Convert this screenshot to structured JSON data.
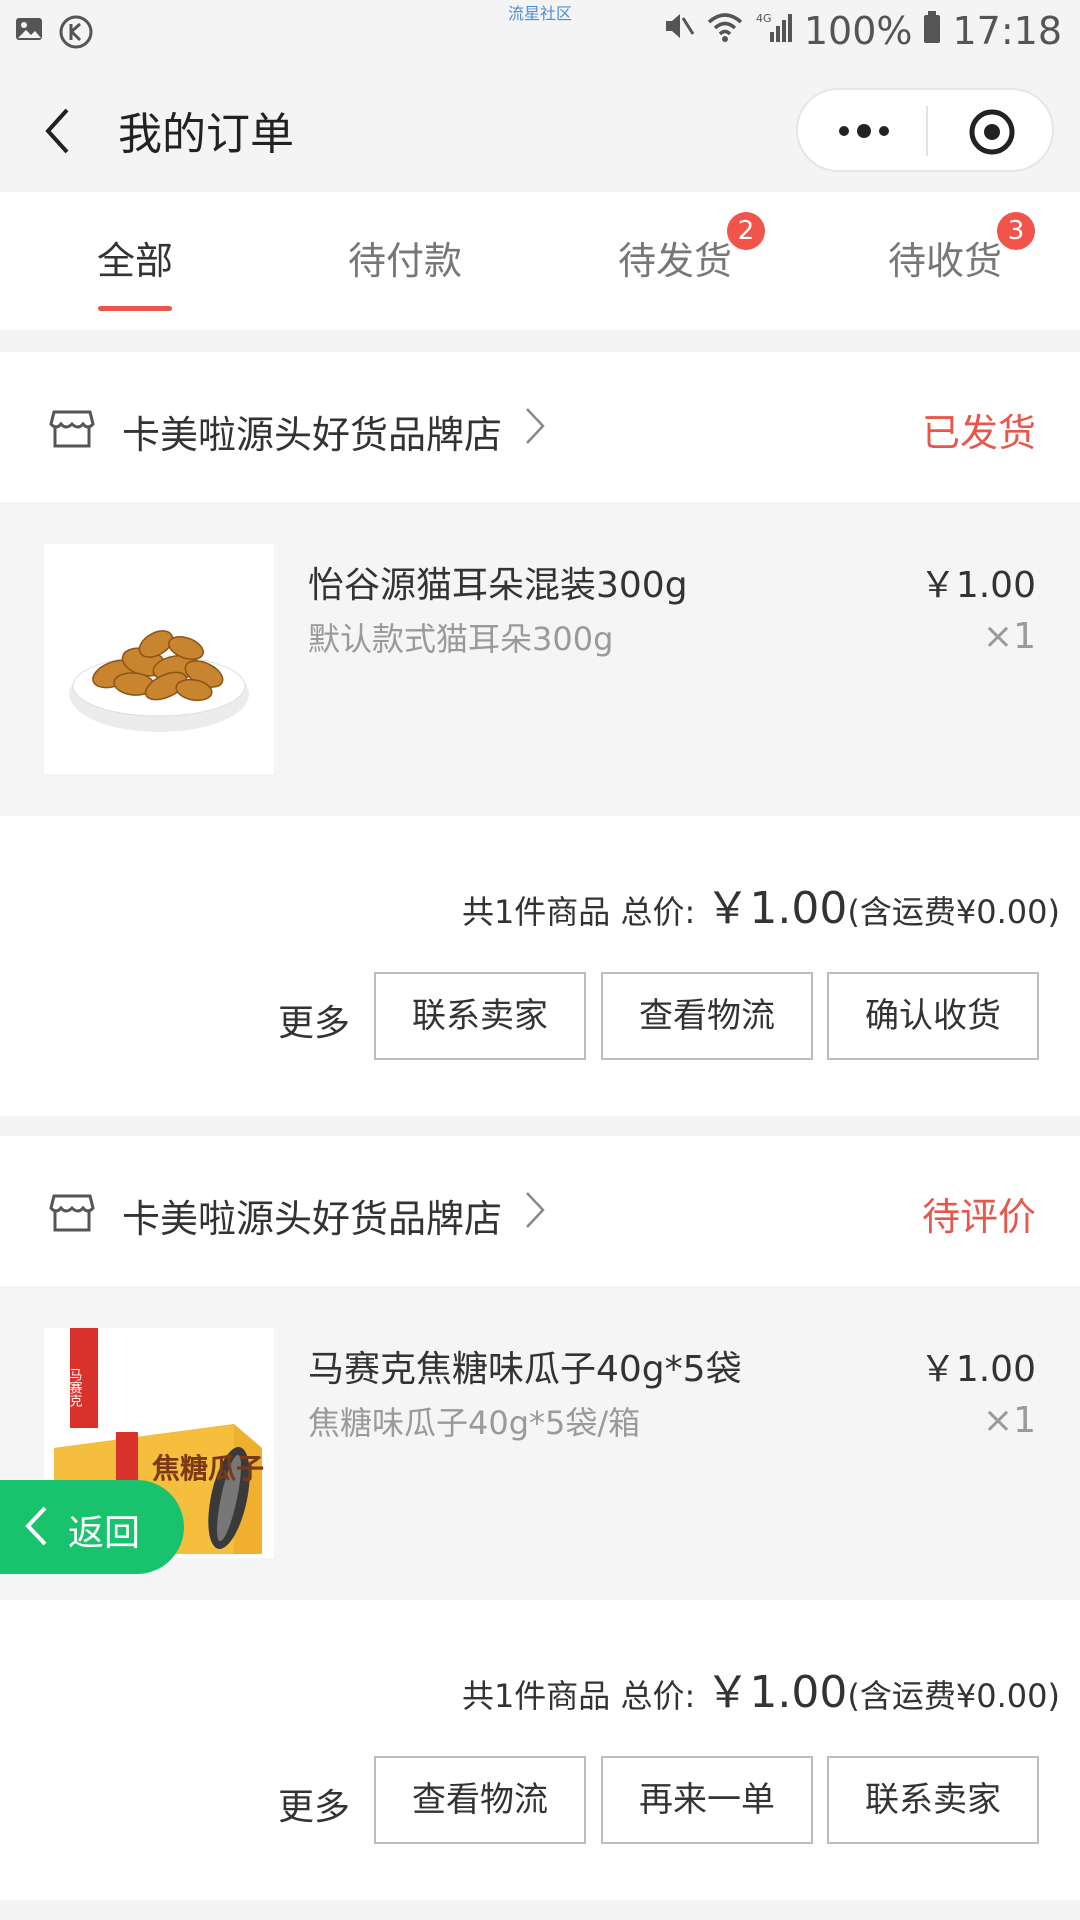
{
  "status_bar": {
    "watermark": "流星社区",
    "battery": "100%",
    "time": "17:18",
    "network": "4G"
  },
  "nav": {
    "title": "我的订单"
  },
  "tabs": [
    {
      "label": "全部",
      "active": true
    },
    {
      "label": "待付款"
    },
    {
      "label": "待发货",
      "badge": "2"
    },
    {
      "label": "待收货",
      "badge": "3"
    }
  ],
  "orders": [
    {
      "shop": "卡美啦源头好货品牌店",
      "status": "已发货",
      "item": {
        "name": "怡谷源猫耳朵混装300g",
        "spec": "默认款式猫耳朵300g",
        "price": "￥1.00",
        "qty": "×1"
      },
      "summary": {
        "count_text": "共1件商品 总价:",
        "total": "￥1.00",
        "shipping": "(含运费¥0.00)"
      },
      "more_label": "更多",
      "buttons": [
        "联系卖家",
        "查看物流",
        "确认收货"
      ]
    },
    {
      "shop": "卡美啦源头好货品牌店",
      "status": "待评价",
      "item": {
        "name": "马赛克焦糖味瓜子40g*5袋",
        "spec": "焦糖味瓜子40g*5袋/箱",
        "price": "￥1.00",
        "qty": "×1",
        "image_text": [
          "马赛克",
          "焦糖瓜子"
        ]
      },
      "summary": {
        "count_text": "共1件商品 总价:",
        "total": "￥1.00",
        "shipping": "(含运费¥0.00)"
      },
      "more_label": "更多",
      "buttons": [
        "查看物流",
        "再来一单",
        "联系卖家"
      ]
    }
  ],
  "floating_back": {
    "label": "返回"
  },
  "colors": {
    "accent": "#e8574b",
    "badge": "#f0544a",
    "back_button": "#19c36e"
  }
}
